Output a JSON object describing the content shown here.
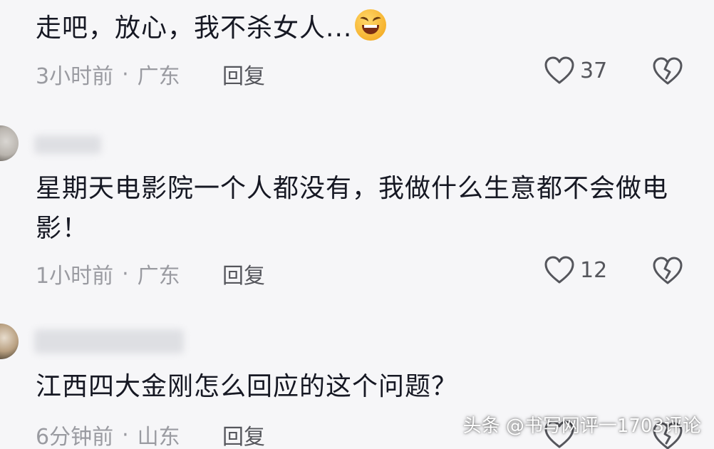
{
  "comments": [
    {
      "text": "走吧，放心，我不杀女人...",
      "emoji": "laughing-emoji",
      "time": "3小时前",
      "location": "广东",
      "reply_label": "回复",
      "likes": "37"
    },
    {
      "text": "星期天电影院一个人都没有，我做什么生意都不会做电影！",
      "time": "1小时前",
      "location": "广东",
      "reply_label": "回复",
      "likes": "12"
    },
    {
      "text": "江西四大金刚怎么回应的这个问题？",
      "time": "6分钟前",
      "location": "山东",
      "reply_label": "回复"
    }
  ],
  "separator": "·",
  "watermark": "头条 @书写网评一1703评论",
  "icons": {
    "like": "heart-outline-icon",
    "dislike": "broken-heart-icon"
  },
  "colors": {
    "background": "#f6f6f8",
    "text": "#161823",
    "meta": "#9a9ba1",
    "icon": "#55565c"
  }
}
